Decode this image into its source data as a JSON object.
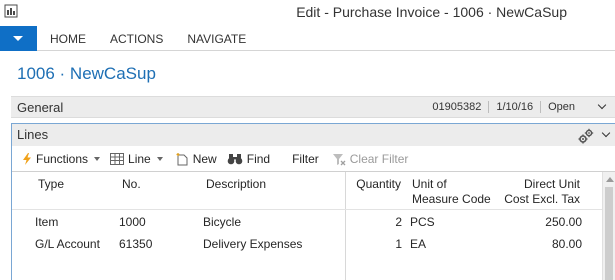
{
  "window": {
    "title": "Edit - Purchase Invoice - 1006 · NewCaSup"
  },
  "ribbon": {
    "tabs": [
      {
        "label": "HOME"
      },
      {
        "label": "ACTIONS"
      },
      {
        "label": "NAVIGATE"
      }
    ]
  },
  "page": {
    "title": "1006 · NewCaSup"
  },
  "general": {
    "label": "General",
    "summary": [
      "01905382",
      "1/10/16",
      "Open"
    ]
  },
  "lines": {
    "label": "Lines",
    "toolbar": {
      "functions": "Functions",
      "line": "Line",
      "new": "New",
      "find": "Find",
      "filter": "Filter",
      "clear_filter": "Clear Filter"
    },
    "columns": {
      "type": "Type",
      "no": "No.",
      "description": "Description",
      "quantity": "Quantity",
      "uom_line1": "Unit of",
      "uom_line2": "Measure Code",
      "cost_line1": "Direct Unit",
      "cost_line2": "Cost Excl. Tax"
    },
    "rows": [
      {
        "type": "Item",
        "no": "1000",
        "description": "Bicycle",
        "quantity": "2",
        "uom": "PCS",
        "cost": "250.00"
      },
      {
        "type": "G/L Account",
        "no": "61350",
        "description": "Delivery Expenses",
        "quantity": "1",
        "uom": "EA",
        "cost": "80.00"
      }
    ]
  },
  "colors": {
    "accent": "#0f6fc6",
    "title_blue": "#1e6fb4"
  }
}
